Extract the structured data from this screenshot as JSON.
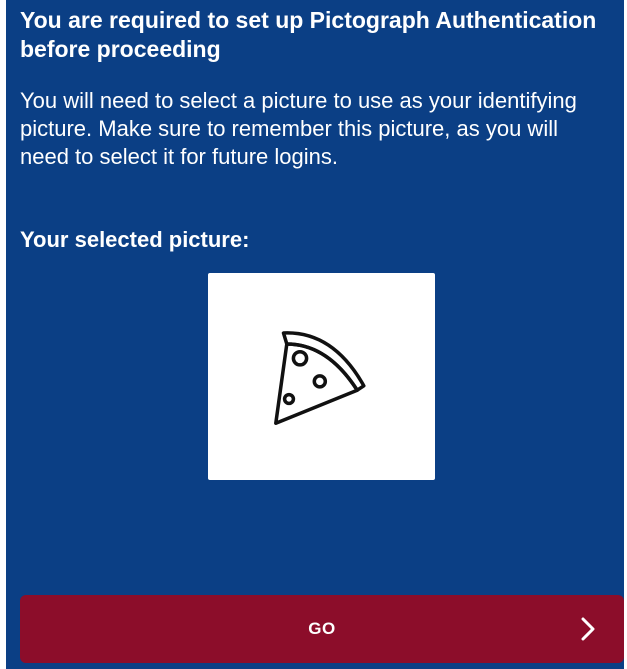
{
  "header": {
    "title": "You are required to set up Pictograph Authentication before proceeding"
  },
  "instructions": {
    "text": "You will need to select a picture to use as your identifying picture. Make sure to remember this picture, as you will need to select it for future logins."
  },
  "selection": {
    "label": "Your selected picture:",
    "picture_icon": "pizza-slice-icon"
  },
  "action": {
    "go_label": "GO",
    "chevron_icon": "chevron-right-icon"
  },
  "colors": {
    "background": "#0b3f85",
    "button": "#8c0d2a",
    "text": "#ffffff"
  }
}
